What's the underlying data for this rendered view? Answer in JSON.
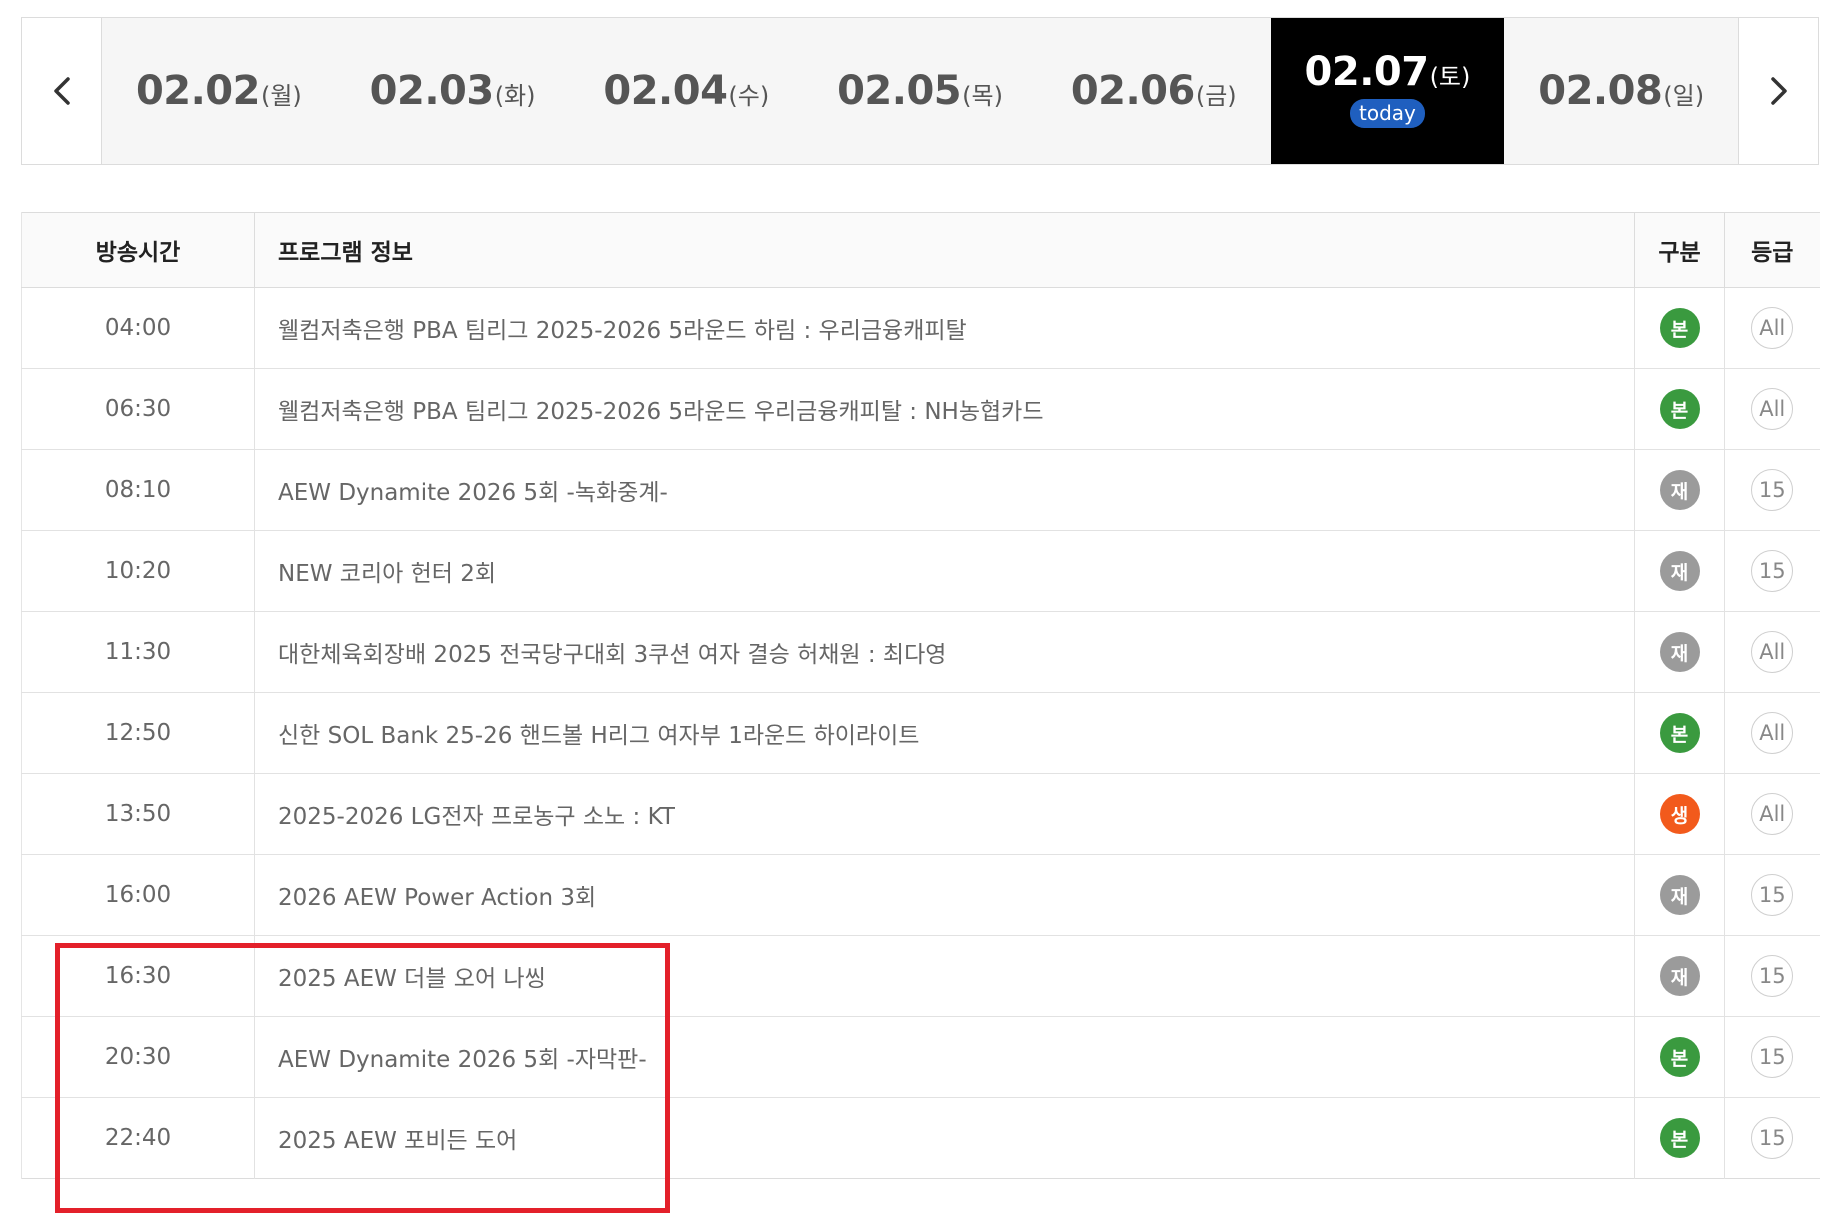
{
  "date_nav": {
    "prev_icon": "chevron-left-icon",
    "next_icon": "chevron-right-icon",
    "dates": [
      {
        "date": "02.02",
        "day": "(월)"
      },
      {
        "date": "02.03",
        "day": "(화)"
      },
      {
        "date": "02.04",
        "day": "(수)"
      },
      {
        "date": "02.05",
        "day": "(목)"
      },
      {
        "date": "02.06",
        "day": "(금)"
      },
      {
        "date": "02.07",
        "day": "(토)",
        "active": true,
        "badge": "today"
      },
      {
        "date": "02.08",
        "day": "(일)"
      }
    ]
  },
  "table": {
    "headers": {
      "time": "방송시간",
      "title": "프로그램 정보",
      "type": "구분",
      "grade": "등급"
    },
    "rows": [
      {
        "time": "04:00",
        "title": "웰컴저축은행 PBA 팀리그 2025-2026 5라운드 하림 : 우리금융캐피탈",
        "type": "본",
        "grade": "All"
      },
      {
        "time": "06:30",
        "title": "웰컴저축은행 PBA 팀리그 2025-2026 5라운드 우리금융캐피탈 : NH농협카드",
        "type": "본",
        "grade": "All"
      },
      {
        "time": "08:10",
        "title": "AEW Dynamite 2026 5회 -녹화중계-",
        "type": "재",
        "grade": "15"
      },
      {
        "time": "10:20",
        "title": "NEW 코리아 헌터 2회",
        "type": "재",
        "grade": "15"
      },
      {
        "time": "11:30",
        "title": "대한체육회장배 2025 전국당구대회 3쿠션 여자 결승 허채원 : 최다영",
        "type": "재",
        "grade": "All"
      },
      {
        "time": "12:50",
        "title": "신한 SOL Bank 25-26 핸드볼 H리그 여자부 1라운드 하이라이트",
        "type": "본",
        "grade": "All"
      },
      {
        "time": "13:50",
        "title": "2025-2026 LG전자 프로농구 소노 : KT",
        "type": "생",
        "grade": "All"
      },
      {
        "time": "16:00",
        "title": "2026 AEW Power Action 3회",
        "type": "재",
        "grade": "15"
      },
      {
        "time": "16:30",
        "title": "2025 AEW 더블 오어 나씽",
        "type": "재",
        "grade": "15"
      },
      {
        "time": "20:30",
        "title": "AEW Dynamite 2026 5회 -자막판-",
        "type": "본",
        "grade": "15"
      },
      {
        "time": "22:40",
        "title": "2025 AEW 포비든 도어",
        "type": "본",
        "grade": "15"
      }
    ]
  },
  "type_colors": {
    "본": "#3a9a3f",
    "재": "#9b9b9b",
    "생": "#f25a1c"
  },
  "highlight_color": "#e3202a"
}
